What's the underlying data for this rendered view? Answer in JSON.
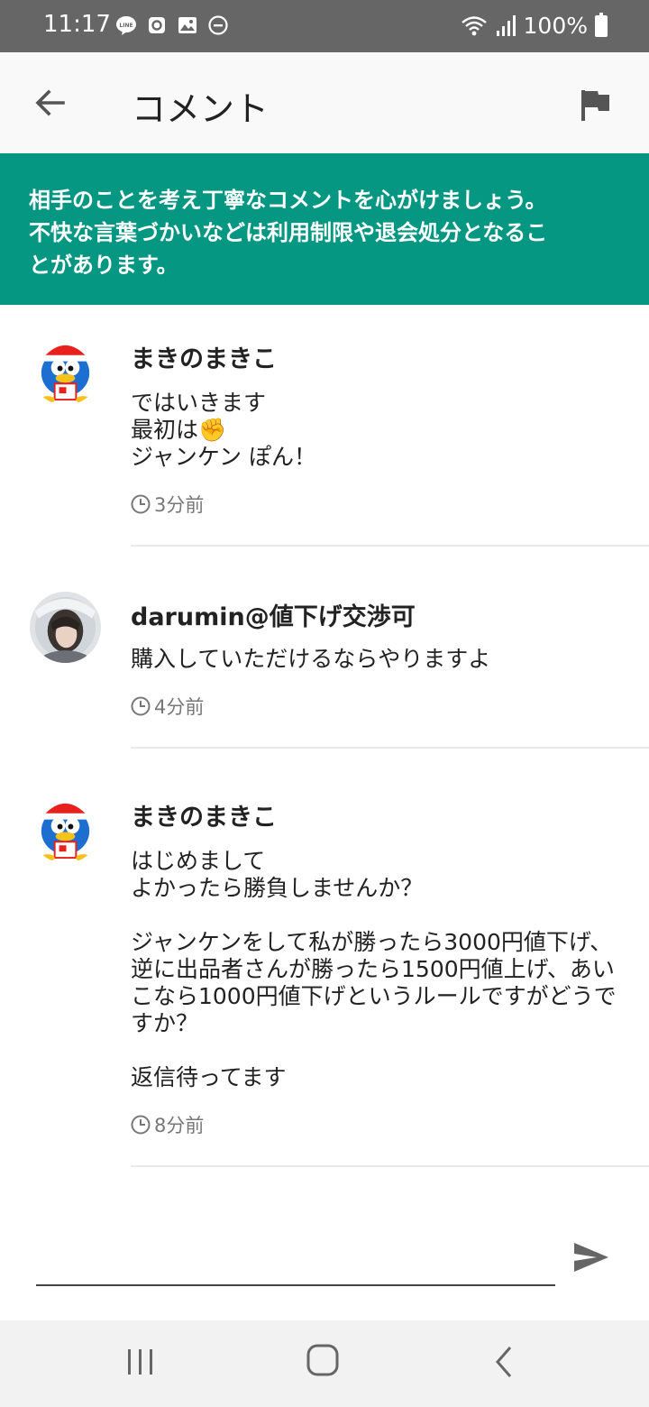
{
  "status_bar": {
    "time": "11:17",
    "battery": "100%",
    "icons": [
      "line-icon",
      "notification-icon",
      "image-icon",
      "dnd-icon",
      "wifi-icon",
      "signal-icon",
      "battery-icon"
    ]
  },
  "header": {
    "title": "コメント",
    "back_icon": "arrow-left-icon",
    "report_icon": "flag-icon"
  },
  "notice": {
    "line1": "相手のことを考え丁寧なコメントを心がけましょう。",
    "line2": "不快な言葉づかいなどは利用制限や退会処分となるこ",
    "line3": "とがあります。",
    "color": "#069783"
  },
  "comments": [
    {
      "author": "まきのまきこ",
      "lines": [
        "ではいきます",
        "最初は✊",
        "ジャンケン ぽん！"
      ],
      "time": "3分前"
    },
    {
      "author": "darumin@値下げ交渉可",
      "lines": [
        "購入していただけるならやりますよ"
      ],
      "time": "4分前"
    },
    {
      "author": "まきのまきこ",
      "lines": [
        "はじめまして",
        "よかったら勝負しませんか？",
        "",
        "ジャンケンをして私が勝ったら3000円値下げ、",
        "逆に出品者さんが勝ったら1500円値上げ、あい",
        "こなら1000円値下げというルールですがどうで",
        "すか？",
        "",
        "返信待ってます"
      ],
      "time": "8分前"
    }
  ],
  "input": {
    "value": "",
    "send_icon": "send-icon"
  },
  "nav_bar": {
    "icons": [
      "recent-apps-icon",
      "home-icon",
      "back-icon"
    ]
  }
}
